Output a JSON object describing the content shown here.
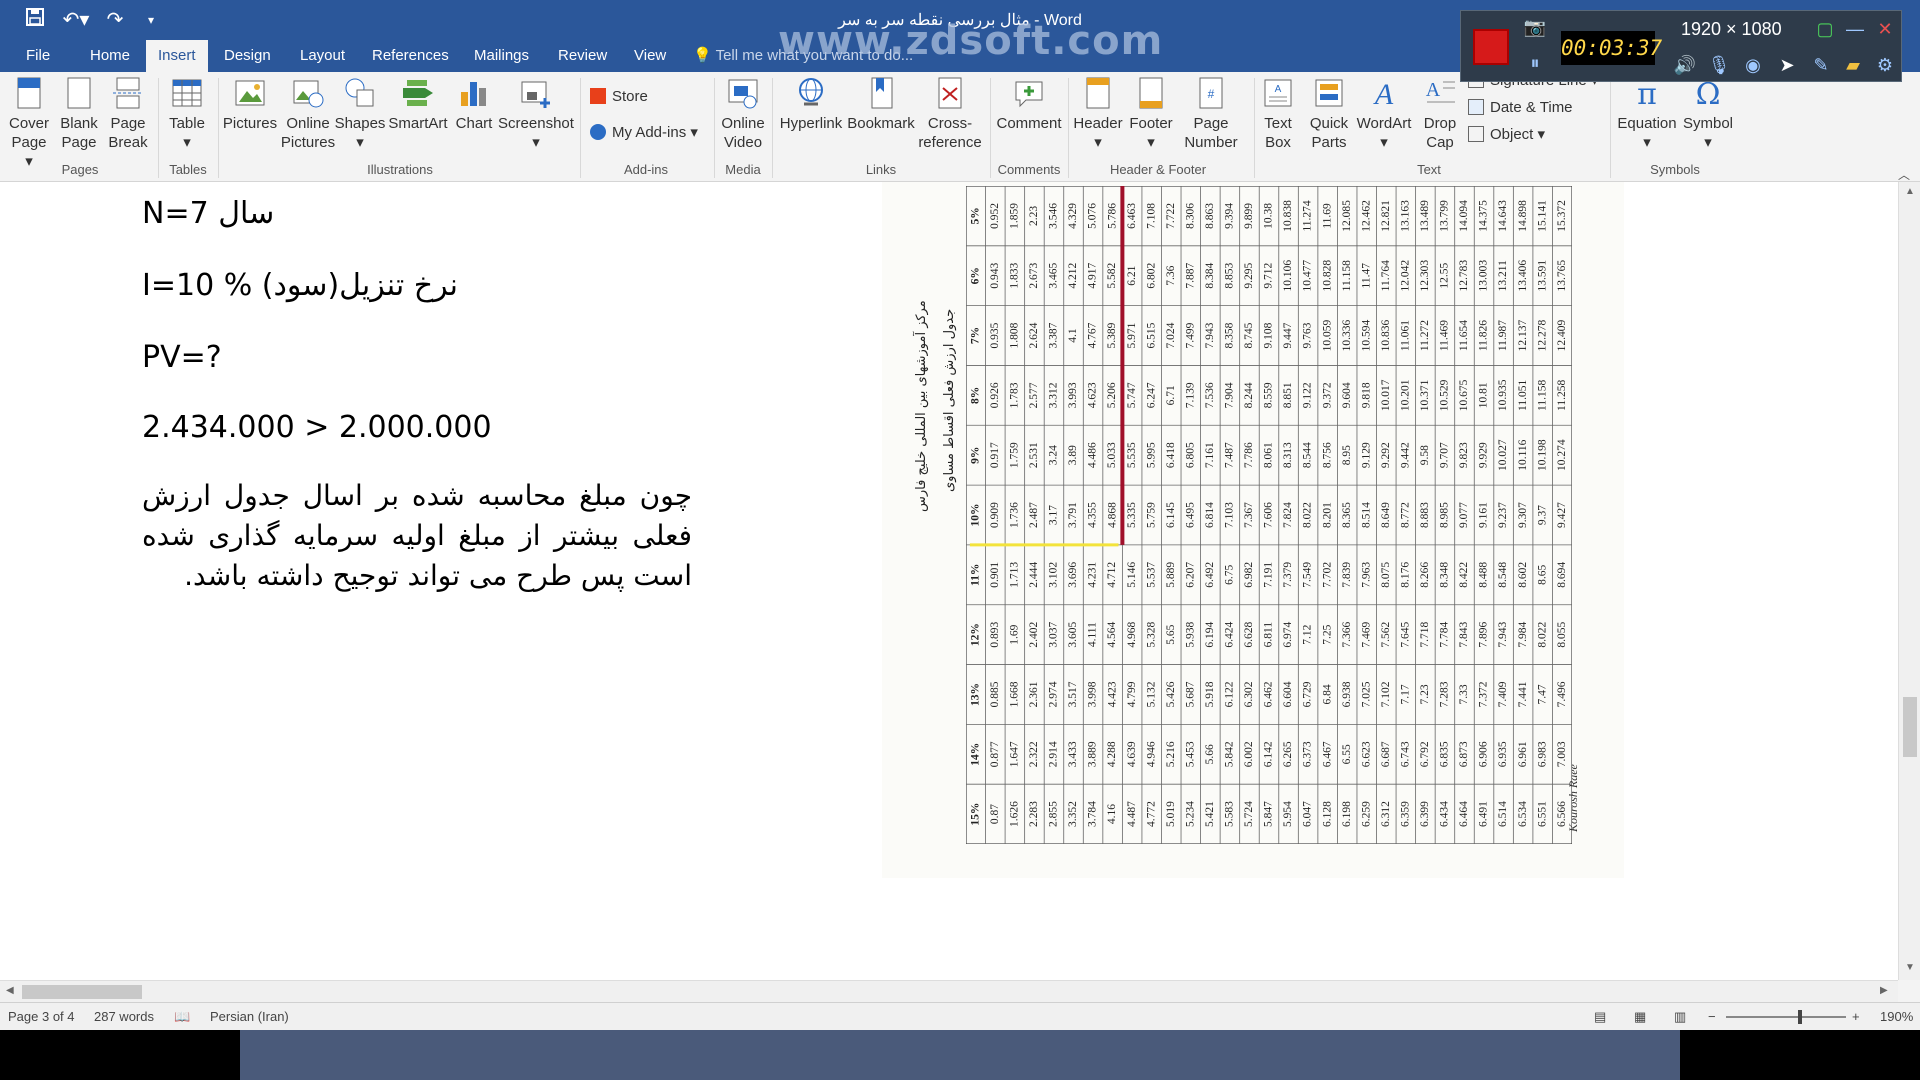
{
  "app": {
    "title": "مثال بررسی نقطه سر به سر - Word",
    "watermark": "www.zdsoft.com"
  },
  "qat": {
    "save_icon": "save-icon",
    "undo_icon": "undo-icon",
    "redo_icon": "redo-icon",
    "customize_icon": "customize-qat-icon"
  },
  "tabs": [
    "File",
    "Home",
    "Insert",
    "Design",
    "Layout",
    "References",
    "Mailings",
    "Review",
    "View"
  ],
  "active_tab": "Insert",
  "tell_me": "Tell me what you want to do...",
  "ribbon": {
    "pages": {
      "cover_page": "Cover Page",
      "blank_page": "Blank Page",
      "page_break": "Page Break",
      "group": "Pages"
    },
    "tables": {
      "table": "Table",
      "group": "Tables"
    },
    "illustrations": {
      "pictures": "Pictures",
      "online_pictures": "Online Pictures",
      "shapes": "Shapes",
      "smartart": "SmartArt",
      "chart": "Chart",
      "screenshot": "Screenshot",
      "group": "Illustrations"
    },
    "addins": {
      "store": "Store",
      "my_addins": "My Add-ins",
      "group": "Add-ins"
    },
    "media": {
      "online_video": "Online Video",
      "group": "Media"
    },
    "links": {
      "hyperlink": "Hyperlink",
      "bookmark": "Bookmark",
      "cross_reference": "Cross-reference",
      "group": "Links"
    },
    "comments": {
      "comment": "Comment",
      "group": "Comments"
    },
    "header_footer": {
      "header": "Header",
      "footer": "Footer",
      "page_number": "Page Number",
      "group": "Header & Footer"
    },
    "text": {
      "text_box": "Text Box",
      "quick_parts": "Quick Parts",
      "wordart": "WordArt",
      "drop_cap": "Drop Cap",
      "signature_line": "Signature Line",
      "date_time": "Date & Time",
      "object": "Object",
      "group": "Text"
    },
    "symbols": {
      "equation": "Equation",
      "symbol": "Symbol",
      "group": "Symbols"
    }
  },
  "recorder": {
    "time": "00:03:37",
    "resolution": "1920 × 1080"
  },
  "document": {
    "line1": "N=7 سال",
    "line2": "I=10 % نرخ تنزیل(سود)",
    "line3": "PV=?",
    "line4": "2.434.000 > 2.000.000",
    "paragraph": "چون مبلغ محاسبه شده بر اسال جدول ارزش فعلی بیشتر از مبلغ اولیه سرمایه گذاری شده است پس طرح می تواند توجیح داشته باشد."
  },
  "scan": {
    "heading1": "مرکز آموزشهای بین المللی خلیج فارس",
    "heading2": "جدول ارزش فعلی اقساط مساوی",
    "signature": "Kourosh Raee",
    "rates": [
      "5%",
      "6%",
      "7%",
      "8%",
      "9%",
      "10%",
      "11%",
      "12%",
      "13%",
      "14%",
      "15%"
    ],
    "rows": [
      [
        "0.952",
        "0.943",
        "0.935",
        "0.926",
        "0.917",
        "0.909",
        "0.901",
        "0.893",
        "0.885",
        "0.877",
        "0.87"
      ],
      [
        "1.859",
        "1.833",
        "1.808",
        "1.783",
        "1.759",
        "1.736",
        "1.713",
        "1.69",
        "1.668",
        "1.647",
        "1.626"
      ],
      [
        "2.23",
        "2.673",
        "2.624",
        "2.577",
        "2.531",
        "2.487",
        "2.444",
        "2.402",
        "2.361",
        "2.322",
        "2.283"
      ],
      [
        "3.546",
        "3.465",
        "3.387",
        "3.312",
        "3.24",
        "3.17",
        "3.102",
        "3.037",
        "2.974",
        "2.914",
        "2.855"
      ],
      [
        "4.329",
        "4.212",
        "4.1",
        "3.993",
        "3.89",
        "3.791",
        "3.696",
        "3.605",
        "3.517",
        "3.433",
        "3.352"
      ],
      [
        "5.076",
        "4.917",
        "4.767",
        "4.623",
        "4.486",
        "4.355",
        "4.231",
        "4.111",
        "3.998",
        "3.889",
        "3.784"
      ],
      [
        "5.786",
        "5.582",
        "5.389",
        "5.206",
        "5.033",
        "4.868",
        "4.712",
        "4.564",
        "4.423",
        "4.288",
        "4.16"
      ],
      [
        "6.463",
        "6.21",
        "5.971",
        "5.747",
        "5.535",
        "5.335",
        "5.146",
        "4.968",
        "4.799",
        "4.639",
        "4.487"
      ],
      [
        "7.108",
        "6.802",
        "6.515",
        "6.247",
        "5.995",
        "5.759",
        "5.537",
        "5.328",
        "5.132",
        "4.946",
        "4.772"
      ],
      [
        "7.722",
        "7.36",
        "7.024",
        "6.71",
        "6.418",
        "6.145",
        "5.889",
        "5.65",
        "5.426",
        "5.216",
        "5.019"
      ],
      [
        "8.306",
        "7.887",
        "7.499",
        "7.139",
        "6.805",
        "6.495",
        "6.207",
        "5.938",
        "5.687",
        "5.453",
        "5.234"
      ],
      [
        "8.863",
        "8.384",
        "7.943",
        "7.536",
        "7.161",
        "6.814",
        "6.492",
        "6.194",
        "5.918",
        "5.66",
        "5.421"
      ],
      [
        "9.394",
        "8.853",
        "8.358",
        "7.904",
        "7.487",
        "7.103",
        "6.75",
        "6.424",
        "6.122",
        "5.842",
        "5.583"
      ],
      [
        "9.899",
        "9.295",
        "8.745",
        "8.244",
        "7.786",
        "7.367",
        "6.982",
        "6.628",
        "6.302",
        "6.002",
        "5.724"
      ],
      [
        "10.38",
        "9.712",
        "9.108",
        "8.559",
        "8.061",
        "7.606",
        "7.191",
        "6.811",
        "6.462",
        "6.142",
        "5.847"
      ],
      [
        "10.838",
        "10.106",
        "9.447",
        "8.851",
        "8.313",
        "7.824",
        "7.379",
        "6.974",
        "6.604",
        "6.265",
        "5.954"
      ],
      [
        "11.274",
        "10.477",
        "9.763",
        "9.122",
        "8.544",
        "8.022",
        "7.549",
        "7.12",
        "6.729",
        "6.373",
        "6.047"
      ],
      [
        "11.69",
        "10.828",
        "10.059",
        "9.372",
        "8.756",
        "8.201",
        "7.702",
        "7.25",
        "6.84",
        "6.467",
        "6.128"
      ],
      [
        "12.085",
        "11.158",
        "10.336",
        "9.604",
        "8.95",
        "8.365",
        "7.839",
        "7.366",
        "6.938",
        "6.55",
        "6.198"
      ],
      [
        "12.462",
        "11.47",
        "10.594",
        "9.818",
        "9.129",
        "8.514",
        "7.963",
        "7.469",
        "7.025",
        "6.623",
        "6.259"
      ],
      [
        "12.821",
        "11.764",
        "10.836",
        "10.017",
        "9.292",
        "8.649",
        "8.075",
        "7.562",
        "7.102",
        "6.687",
        "6.312"
      ],
      [
        "13.163",
        "12.042",
        "11.061",
        "10.201",
        "9.442",
        "8.772",
        "8.176",
        "7.645",
        "7.17",
        "6.743",
        "6.359"
      ],
      [
        "13.489",
        "12.303",
        "11.272",
        "10.371",
        "9.58",
        "8.883",
        "8.266",
        "7.718",
        "7.23",
        "6.792",
        "6.399"
      ],
      [
        "13.799",
        "12.55",
        "11.469",
        "10.529",
        "9.707",
        "8.985",
        "8.348",
        "7.784",
        "7.283",
        "6.835",
        "6.434"
      ],
      [
        "14.094",
        "12.783",
        "11.654",
        "10.675",
        "9.823",
        "9.077",
        "8.422",
        "7.843",
        "7.33",
        "6.873",
        "6.464"
      ],
      [
        "14.375",
        "13.003",
        "11.826",
        "10.81",
        "9.929",
        "9.161",
        "8.488",
        "7.896",
        "7.372",
        "6.906",
        "6.491"
      ],
      [
        "14.643",
        "13.211",
        "11.987",
        "10.935",
        "10.027",
        "9.237",
        "8.548",
        "7.943",
        "7.409",
        "6.935",
        "6.514"
      ],
      [
        "14.898",
        "13.406",
        "12.137",
        "11.051",
        "10.116",
        "9.307",
        "8.602",
        "7.984",
        "7.441",
        "6.961",
        "6.534"
      ],
      [
        "15.141",
        "13.591",
        "12.278",
        "11.158",
        "10.198",
        "9.37",
        "8.65",
        "8.022",
        "7.47",
        "6.983",
        "6.551"
      ],
      [
        "15.372",
        "13.765",
        "12.409",
        "11.258",
        "10.274",
        "9.427",
        "8.694",
        "8.055",
        "7.496",
        "7.003",
        "6.566"
      ]
    ]
  },
  "status": {
    "page": "Page 3 of 4",
    "words": "287 words",
    "language": "Persian (Iran)",
    "zoom": "190%"
  },
  "colors": {
    "accent": "#2b579a",
    "red_line": "#a0102a",
    "highlight": "#f3e33b"
  }
}
